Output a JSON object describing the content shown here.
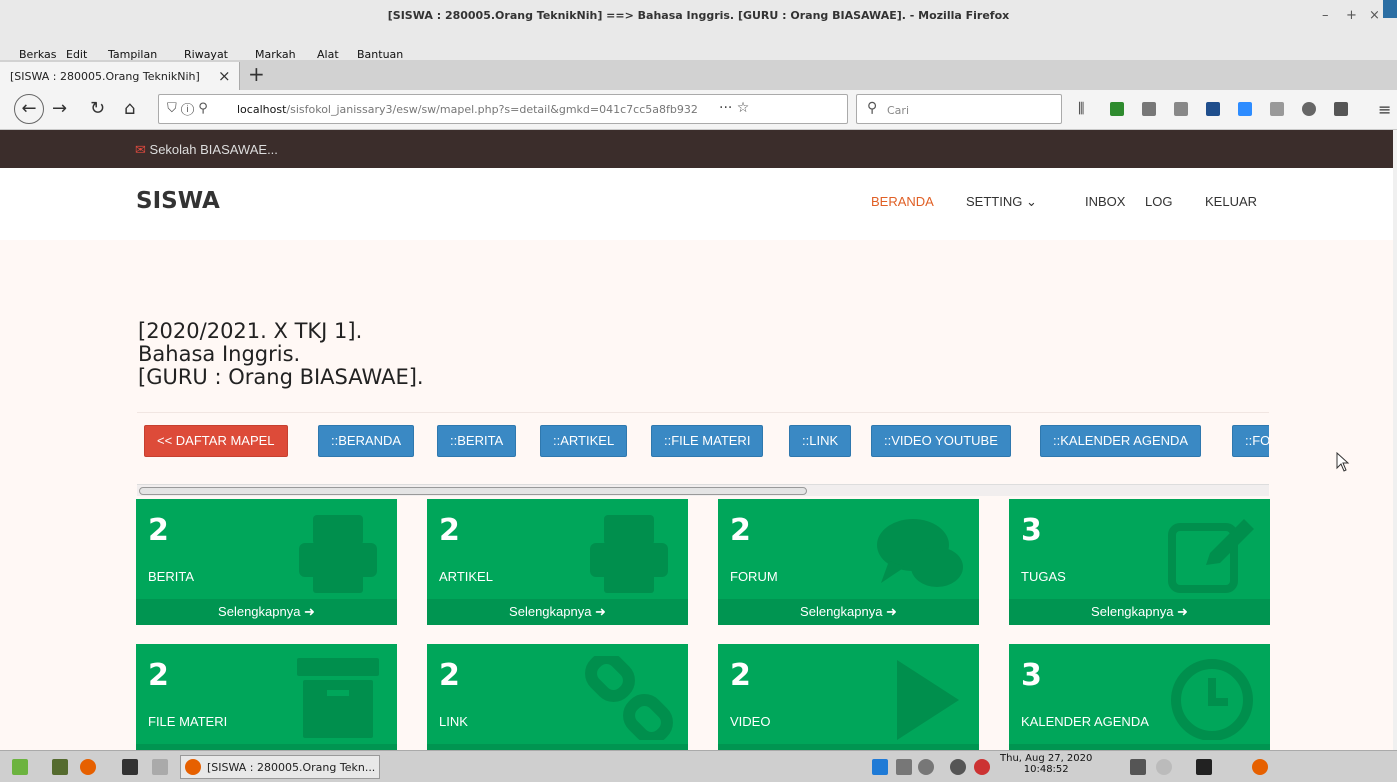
{
  "window": {
    "title": "[SISWA : 280005.Orang TeknikNih] ==> Bahasa Inggris. [GURU : Orang BIASAWAE]. - Mozilla Firefox",
    "controls": [
      "–",
      "+",
      "×"
    ]
  },
  "menu": [
    "Berkas",
    "Edit",
    "Tampilan",
    "Riwayat",
    "Markah",
    "Alat",
    "Bantuan"
  ],
  "tab": {
    "label": "[SISWA : 280005.Orang TeknikNih]",
    "close": "×",
    "new": "+"
  },
  "nav": {
    "url_host": "localhost",
    "url_path": "/sisfokol_janissary3/esw/sw/mapel.php?s=detail&gmkd=041c7cc5a8fb932",
    "url_actions": "···  ☆",
    "search_placeholder": "Cari"
  },
  "site": {
    "school": "Sekolah BIASAWAE...",
    "brand": "SISWA",
    "menu": [
      "BERANDA",
      "SETTING ⌄",
      "INBOX",
      "LOG",
      "KELUAR"
    ]
  },
  "heading": [
    "[2020/2021. X TKJ 1].",
    "Bahasa Inggris.",
    "[GURU : Orang BIASAWAE]."
  ],
  "buttons": [
    "<< DAFTAR MAPEL",
    "::BERANDA",
    "::BERITA",
    "::ARTIKEL",
    "::FILE MATERI",
    "::LINK",
    "::VIDEO YOUTUBE",
    "::KALENDER AGENDA",
    "::FORUM"
  ],
  "cards": [
    {
      "count": "2",
      "label": "BERITA",
      "icon": "printer-icon"
    },
    {
      "count": "2",
      "label": "ARTIKEL",
      "icon": "printer-icon"
    },
    {
      "count": "2",
      "label": "FORUM",
      "icon": "chat-icon"
    },
    {
      "count": "3",
      "label": "TUGAS",
      "icon": "edit-icon"
    },
    {
      "count": "2",
      "label": "FILE MATERI",
      "icon": "archive-icon"
    },
    {
      "count": "2",
      "label": "LINK",
      "icon": "chain-icon"
    },
    {
      "count": "2",
      "label": "VIDEO",
      "icon": "play-icon"
    },
    {
      "count": "3",
      "label": "KALENDER AGENDA",
      "icon": "clock-icon"
    }
  ],
  "more_label": "Selengkapnya ➜",
  "taskbar": {
    "window": "[SISWA : 280005.Orang Tekn...",
    "date": "Thu, Aug 27, 2020",
    "time": "10:48:52"
  },
  "colors": {
    "card": "#00a65a",
    "button": "#3a89c4",
    "button_red": "#dd4b39",
    "topbar": "#3b2d2b",
    "active_nav": "#e06026"
  }
}
